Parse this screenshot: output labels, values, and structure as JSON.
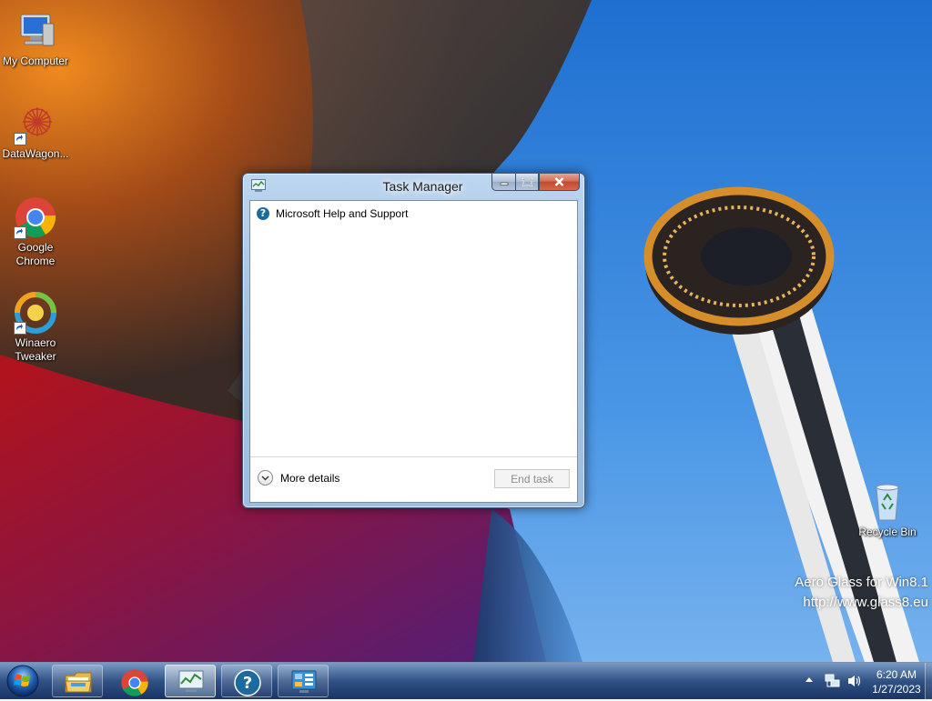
{
  "desktop": {
    "icons": [
      {
        "label": "My Computer"
      },
      {
        "label": "DataWagon..."
      },
      {
        "label": "Google Chrome"
      },
      {
        "label": "Winaero Tweaker"
      },
      {
        "label": "Recycle Bin"
      }
    ],
    "watermark": {
      "line1": "Aero Glass for Win8.1",
      "line2": "http://www.glass8.eu"
    }
  },
  "task_manager": {
    "title": "Task Manager",
    "apps": [
      {
        "name": "Microsoft Help and Support",
        "icon": "help-icon"
      }
    ],
    "more_details_label": "More details",
    "end_task_label": "End task",
    "end_task_enabled": false
  },
  "taskbar": {
    "pinned": [
      {
        "name": "File Explorer",
        "icon": "folder-icon"
      },
      {
        "name": "Google Chrome",
        "icon": "chrome-icon"
      },
      {
        "name": "Task Manager",
        "icon": "task-manager-icon",
        "active": true
      },
      {
        "name": "Help and Support",
        "icon": "help-icon"
      },
      {
        "name": "Control Panel",
        "icon": "control-panel-icon"
      }
    ],
    "clock": {
      "time": "6:20 AM",
      "date": "1/27/2023"
    }
  },
  "colors": {
    "sky_blue": "#2f7fd8",
    "taskbar_blue": "#1f3f78",
    "close_red": "#c94a2e"
  }
}
